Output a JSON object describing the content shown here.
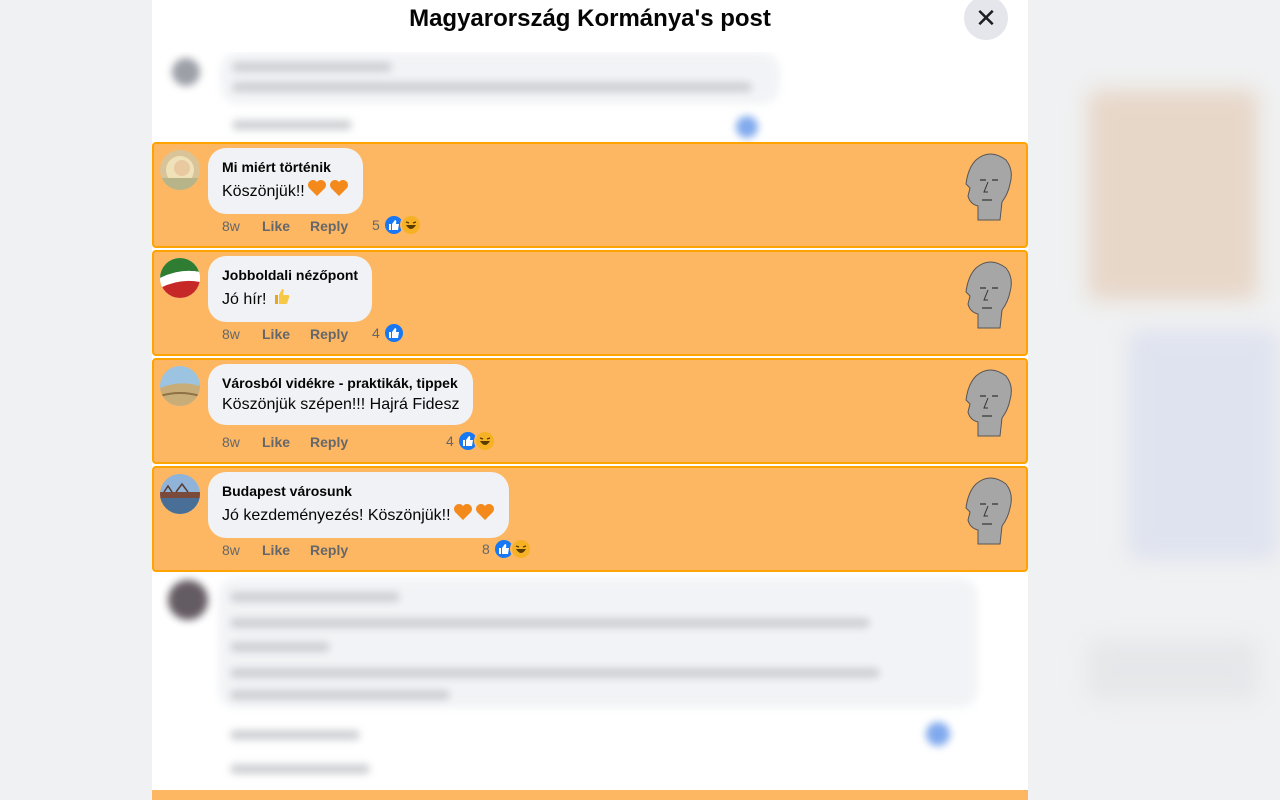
{
  "modal": {
    "title": "Magyarország Kormánya's post",
    "close_icon": "close-icon"
  },
  "comments": [
    {
      "author": "Mi miért történik",
      "text": "Köszönjük!!",
      "emoji": [
        "orange-heart",
        "orange-heart"
      ],
      "time": "8w",
      "like": "Like",
      "reply": "Reply",
      "reaction_count": "5",
      "reactions": [
        "like",
        "haha"
      ]
    },
    {
      "author": "Jobboldali nézőpont",
      "text": "Jó hír!",
      "emoji": [
        "thumbs-up"
      ],
      "time": "8w",
      "like": "Like",
      "reply": "Reply",
      "reaction_count": "4",
      "reactions": [
        "like"
      ]
    },
    {
      "author": "Városból vidékre - praktikák, tippek",
      "text": "Köszönjük szépen!!! Hajrá Fidesz",
      "emoji": [],
      "time": "8w",
      "like": "Like",
      "reply": "Reply",
      "reaction_count": "4",
      "reactions": [
        "like",
        "haha"
      ]
    },
    {
      "author": "Budapest városunk",
      "text": "Jó kezdeményezés! Köszönjük!!",
      "emoji": [
        "orange-heart",
        "orange-heart"
      ],
      "time": "8w",
      "like": "Like",
      "reply": "Reply",
      "reaction_count": "8",
      "reactions": [
        "like",
        "haha"
      ]
    }
  ],
  "colors": {
    "highlight_bg": "#fdb762",
    "highlight_border": "#ffa300",
    "like_blue": "#1877f2",
    "bubble_bg": "#f0f2f5"
  }
}
